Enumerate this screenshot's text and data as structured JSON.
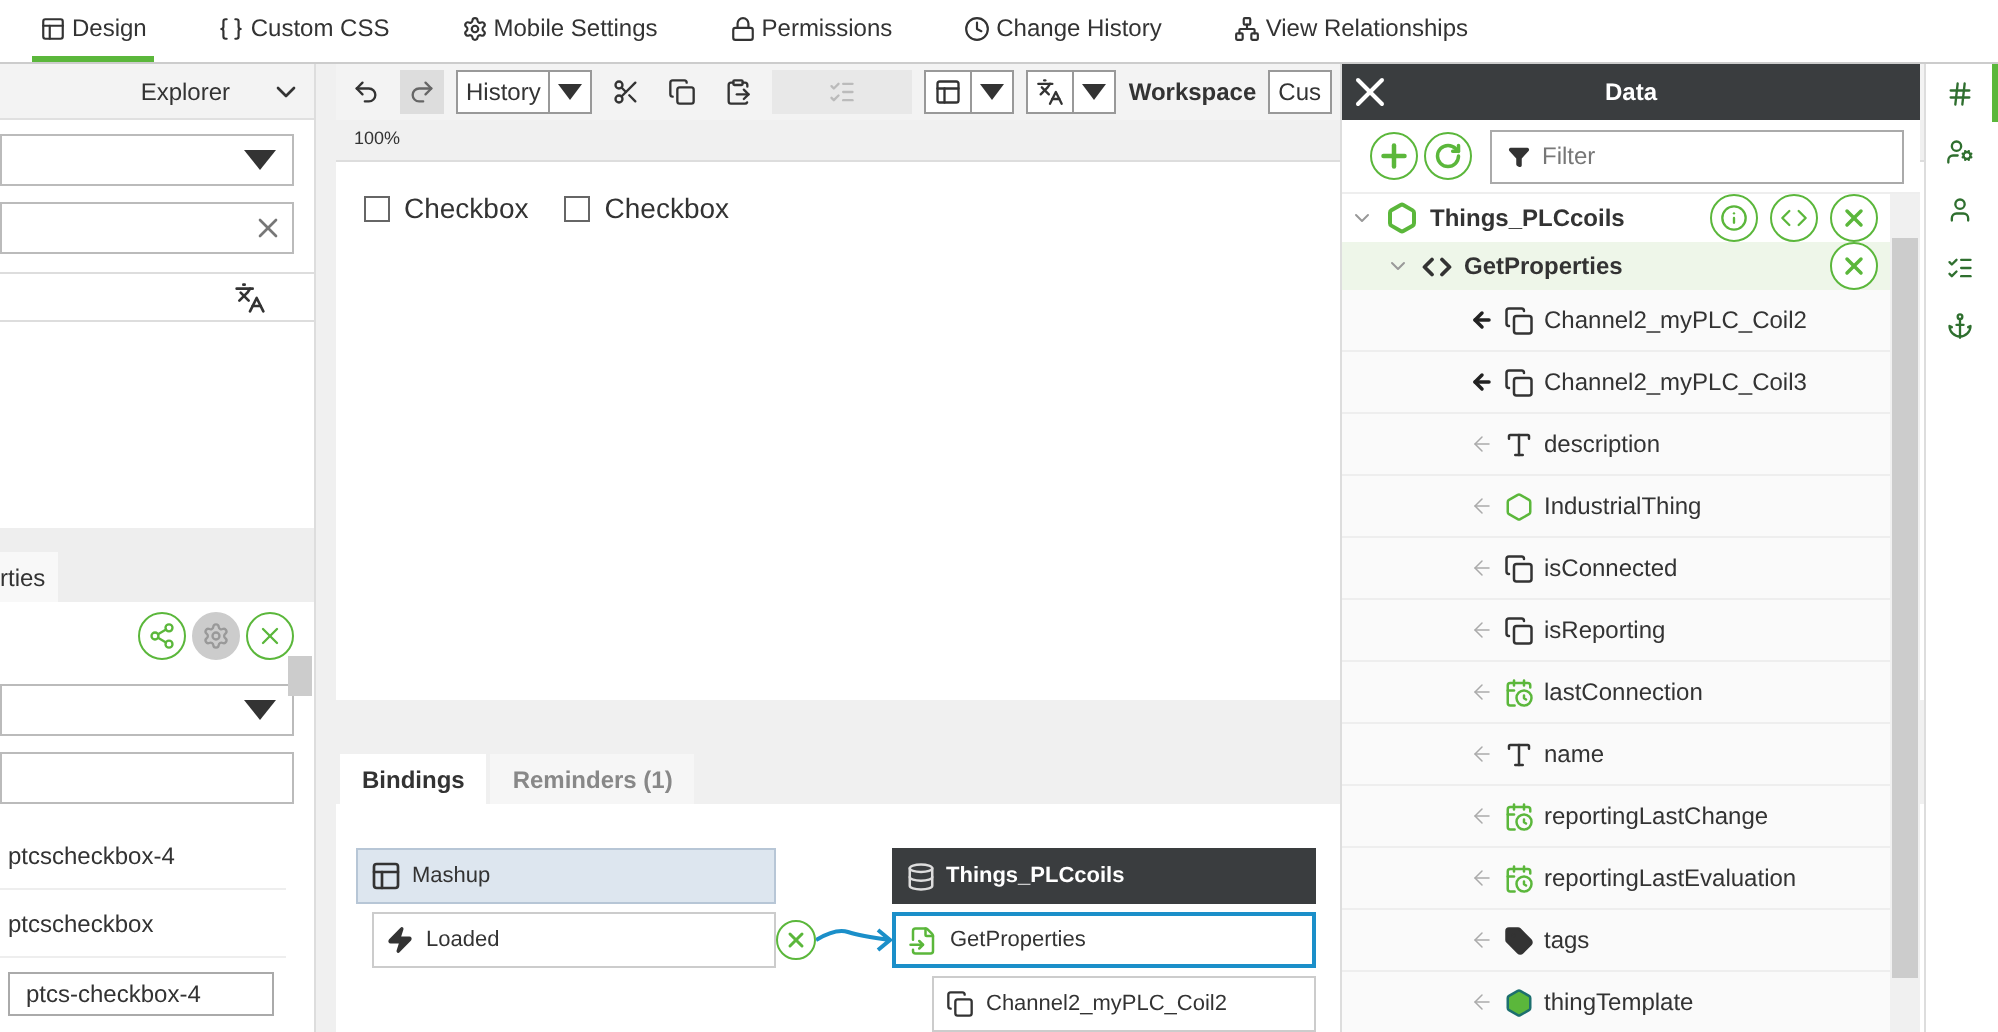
{
  "top_tabs": [
    {
      "label": "Design",
      "selected": true
    },
    {
      "label": "Custom CSS",
      "selected": false
    },
    {
      "label": "Mobile Settings",
      "selected": false
    },
    {
      "label": "Permissions",
      "selected": false
    },
    {
      "label": "Change History",
      "selected": false
    },
    {
      "label": "View Relationships",
      "selected": false
    }
  ],
  "left_panel": {
    "explorer": "Explorer",
    "properties_tab": "rties",
    "list": [
      "ptcscheckbox-4",
      "ptcscheckbox"
    ],
    "id_value": "ptcs-checkbox-4"
  },
  "toolbar": {
    "history": "History",
    "workspace_label": "Workspace",
    "workspace_value": "Cus"
  },
  "canvas": {
    "zoom": "100%",
    "checkboxes": [
      {
        "label": "Checkbox",
        "checked": false
      },
      {
        "label": "Checkbox",
        "checked": false
      }
    ]
  },
  "bindings": {
    "tabs": [
      {
        "label": "Bindings",
        "selected": true
      },
      {
        "label": "Reminders (1)",
        "selected": false
      }
    ],
    "source": {
      "title": "Mashup",
      "event": "Loaded"
    },
    "target": {
      "title": "Things_PLCcoils",
      "service": "GetProperties",
      "output": "Channel2_myPLC_Coil2"
    }
  },
  "data_panel": {
    "title": "Data",
    "filter_placeholder": "Filter",
    "tree": [
      {
        "label": "Things_PLCcoils",
        "expanded": true,
        "children": [
          {
            "label": "GetProperties",
            "expanded": true,
            "children": [
              {
                "label": "Channel2_myPLC_Coil2",
                "kind": "boolean",
                "bound": true
              },
              {
                "label": "Channel2_myPLC_Coil3",
                "kind": "boolean",
                "bound": true
              },
              {
                "label": "description",
                "kind": "text",
                "bound": false
              },
              {
                "label": "IndustrialThing",
                "kind": "shape",
                "bound": false
              },
              {
                "label": "isConnected",
                "kind": "boolean",
                "bound": false
              },
              {
                "label": "isReporting",
                "kind": "boolean",
                "bound": false
              },
              {
                "label": "lastConnection",
                "kind": "datetime",
                "bound": false
              },
              {
                "label": "name",
                "kind": "text",
                "bound": false
              },
              {
                "label": "reportingLastChange",
                "kind": "datetime",
                "bound": false
              },
              {
                "label": "reportingLastEvaluation",
                "kind": "datetime",
                "bound": false
              },
              {
                "label": "tags",
                "kind": "tag",
                "bound": false
              },
              {
                "label": "thingTemplate",
                "kind": "template",
                "bound": false
              }
            ]
          }
        ]
      }
    ]
  },
  "right_rail": [
    {
      "selected": true
    },
    {
      "selected": false
    },
    {
      "selected": false
    },
    {
      "selected": false
    },
    {
      "selected": false
    }
  ]
}
